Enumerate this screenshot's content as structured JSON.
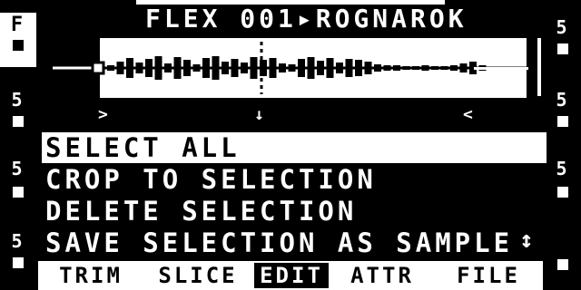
{
  "title": "FLEX 001▸rognarok",
  "side_left": {
    "top_letter": "F",
    "labels": [
      "5",
      "5",
      "5"
    ]
  },
  "side_right": {
    "labels": [
      "5",
      "5",
      "5"
    ]
  },
  "waveform": {
    "markers": [
      ">",
      "↓",
      "<"
    ]
  },
  "menu": {
    "items": [
      {
        "label": "SELECT ALL",
        "selected": true
      },
      {
        "label": "CROP TO SELECTION",
        "selected": false
      },
      {
        "label": "DELETE SELECTION",
        "selected": false
      },
      {
        "label": "SAVE SELECTION AS SAMPLE",
        "selected": false
      }
    ]
  },
  "scroll_icon": "↕",
  "tabs": [
    {
      "label": "TRIM",
      "active": false
    },
    {
      "label": "SLICE",
      "active": false
    },
    {
      "label": "EDIT",
      "active": true
    },
    {
      "label": "ATTR",
      "active": false
    },
    {
      "label": "FILE",
      "active": false
    }
  ]
}
